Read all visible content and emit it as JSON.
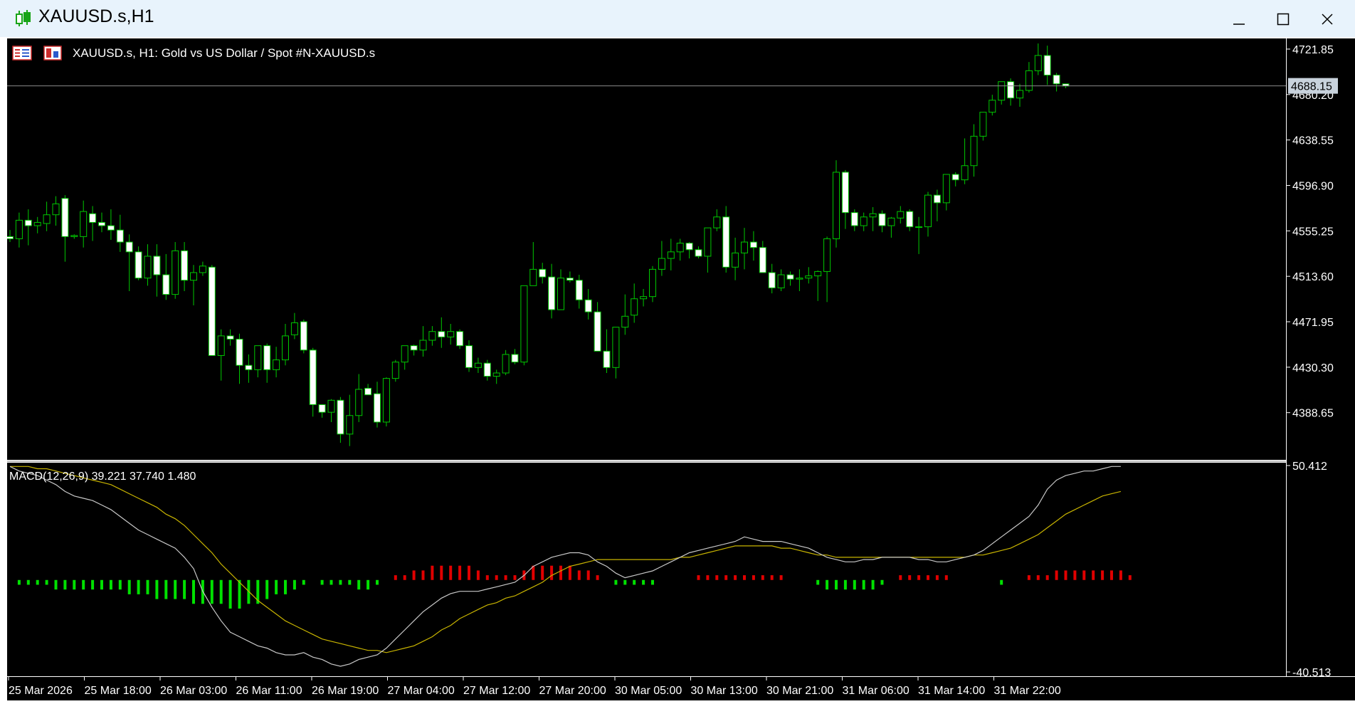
{
  "window": {
    "title": "XAUUSD.s,H1",
    "minimize": "—",
    "maximize": "☐",
    "close": "✕"
  },
  "chart_info": {
    "header": "XAUUSD.s, H1:  Gold vs US Dollar / Spot #N-XAUUSD.s",
    "current_price": "4688.15",
    "macd_label": "MACD(12,26,9) 39.221 37.740 1.480",
    "icons": [
      "list-icon",
      "trade-panel-icon"
    ]
  },
  "colors": {
    "background": "#000000",
    "bull_candle": "#00c800",
    "bear_body": "#ffffff",
    "axis_text": "#ffffff",
    "macd_line": "#c8c8c8",
    "signal_line": "#c8b400",
    "hist_positive": "#e10000",
    "hist_negative": "#00e100",
    "titlebar": "#e8f3fc"
  },
  "chart_data": [
    {
      "type": "candlestick",
      "title": "XAUUSD.s, H1:  Gold vs US Dollar / Spot #N-XAUUSD.s",
      "ylim": [
        4348,
        4729
      ],
      "y_ticks": [
        "4721.85",
        "4680.20",
        "4638.55",
        "4596.90",
        "4555.25",
        "4513.60",
        "4471.95",
        "4430.30",
        "4388.65"
      ],
      "x_ticks": [
        "25 Mar 2026",
        "25 Mar 18:00",
        "26 Mar 03:00",
        "26 Mar 11:00",
        "26 Mar 19:00",
        "27 Mar 04:00",
        "27 Mar 12:00",
        "27 Mar 20:00",
        "30 Mar 05:00",
        "30 Mar 13:00",
        "30 Mar 21:00",
        "31 Mar 06:00",
        "31 Mar 14:00",
        "31 Mar 22:00"
      ],
      "current_price": 4688.15,
      "ohlc": [
        [
          4550,
          4556,
          4545,
          4548
        ],
        [
          4548,
          4572,
          4540,
          4565
        ],
        [
          4565,
          4575,
          4542,
          4560
        ],
        [
          4560,
          4568,
          4553,
          4563
        ],
        [
          4562,
          4582,
          4555,
          4570
        ],
        [
          4570,
          4587,
          4560,
          4580
        ],
        [
          4585,
          4588,
          4527,
          4550
        ],
        [
          4550,
          4552,
          4548,
          4551
        ],
        [
          4550,
          4583,
          4540,
          4573
        ],
        [
          4571,
          4578,
          4546,
          4563
        ],
        [
          4563,
          4572,
          4554,
          4560
        ],
        [
          4560,
          4575,
          4547,
          4556
        ],
        [
          4556,
          4570,
          4536,
          4545
        ],
        [
          4545,
          4552,
          4500,
          4536
        ],
        [
          4536,
          4541,
          4510,
          4512
        ],
        [
          4512,
          4543,
          4505,
          4532
        ],
        [
          4532,
          4543,
          4495,
          4515
        ],
        [
          4515,
          4534,
          4492,
          4497
        ],
        [
          4497,
          4545,
          4493,
          4537
        ],
        [
          4537,
          4545,
          4500,
          4510
        ],
        [
          4510,
          4524,
          4487,
          4517
        ],
        [
          4517,
          4527,
          4514,
          4523
        ],
        [
          4522,
          4524,
          4447,
          4441
        ],
        [
          4441,
          4465,
          4418,
          4459
        ],
        [
          4459,
          4465,
          4450,
          4456
        ],
        [
          4456,
          4461,
          4415,
          4432
        ],
        [
          4432,
          4442,
          4416,
          4428
        ],
        [
          4428,
          4446,
          4421,
          4450
        ],
        [
          4450,
          4452,
          4416,
          4428
        ],
        [
          4428,
          4449,
          4421,
          4437
        ],
        [
          4437,
          4470,
          4432,
          4459
        ],
        [
          4460,
          4480,
          4456,
          4471
        ],
        [
          4472,
          4474,
          4443,
          4446
        ],
        [
          4446,
          4448,
          4385,
          4396
        ],
        [
          4396,
          4396,
          4384,
          4389
        ],
        [
          4389,
          4401,
          4380,
          4400
        ],
        [
          4400,
          4403,
          4361,
          4369
        ],
        [
          4369,
          4405,
          4358,
          4386
        ],
        [
          4386,
          4424,
          4380,
          4410
        ],
        [
          4411,
          4415,
          4408,
          4405
        ],
        [
          4406,
          4417,
          4375,
          4380
        ],
        [
          4380,
          4421,
          4376,
          4420
        ],
        [
          4420,
          4437,
          4417,
          4435
        ],
        [
          4435,
          4445,
          4428,
          4450
        ],
        [
          4450,
          4451,
          4441,
          4446
        ],
        [
          4446,
          4468,
          4440,
          4455
        ],
        [
          4455,
          4468,
          4450,
          4463
        ],
        [
          4463,
          4476,
          4448,
          4458
        ],
        [
          4458,
          4470,
          4451,
          4463
        ],
        [
          4463,
          4465,
          4447,
          4450
        ],
        [
          4450,
          4455,
          4426,
          4430
        ],
        [
          4430,
          4439,
          4425,
          4434
        ],
        [
          4434,
          4437,
          4418,
          4422
        ],
        [
          4422,
          4428,
          4415,
          4425
        ],
        [
          4425,
          4446,
          4423,
          4442
        ],
        [
          4442,
          4447,
          4433,
          4435
        ],
        [
          4435,
          4503,
          4432,
          4505
        ],
        [
          4505,
          4545,
          4505,
          4520
        ],
        [
          4520,
          4526,
          4507,
          4513
        ],
        [
          4513,
          4525,
          4475,
          4483
        ],
        [
          4483,
          4520,
          4483,
          4512
        ],
        [
          4512,
          4518,
          4508,
          4510
        ],
        [
          4510,
          4515,
          4484,
          4492
        ],
        [
          4492,
          4502,
          4474,
          4481
        ],
        [
          4481,
          4490,
          4452,
          4445
        ],
        [
          4445,
          4465,
          4425,
          4430
        ],
        [
          4430,
          4466,
          4420,
          4467
        ],
        [
          4467,
          4497,
          4460,
          4477
        ],
        [
          4478,
          4507,
          4471,
          4493
        ],
        [
          4493,
          4502,
          4486,
          4495
        ],
        [
          4495,
          4523,
          4490,
          4520
        ],
        [
          4520,
          4546,
          4514,
          4530
        ],
        [
          4530,
          4548,
          4519,
          4536
        ],
        [
          4536,
          4548,
          4528,
          4544
        ],
        [
          4544,
          4545,
          4530,
          4538
        ],
        [
          4538,
          4541,
          4530,
          4532
        ],
        [
          4532,
          4552,
          4517,
          4558
        ],
        [
          4558,
          4575,
          4555,
          4568
        ],
        [
          4568,
          4578,
          4517,
          4522
        ],
        [
          4522,
          4549,
          4510,
          4535
        ],
        [
          4535,
          4558,
          4520,
          4545
        ],
        [
          4545,
          4555,
          4528,
          4540
        ],
        [
          4540,
          4546,
          4517,
          4517
        ],
        [
          4517,
          4525,
          4498,
          4503
        ],
        [
          4503,
          4520,
          4500,
          4515
        ],
        [
          4515,
          4518,
          4505,
          4511
        ],
        [
          4511,
          4520,
          4500,
          4512
        ],
        [
          4512,
          4522,
          4507,
          4514
        ],
        [
          4514,
          4519,
          4491,
          4518
        ],
        [
          4518,
          4550,
          4490,
          4548
        ],
        [
          4548,
          4620,
          4540,
          4609
        ],
        [
          4609,
          4611,
          4557,
          4572
        ],
        [
          4572,
          4575,
          4555,
          4560
        ],
        [
          4560,
          4572,
          4555,
          4568
        ],
        [
          4568,
          4577,
          4555,
          4571
        ],
        [
          4571,
          4574,
          4554,
          4560
        ],
        [
          4560,
          4568,
          4549,
          4567
        ],
        [
          4567,
          4578,
          4562,
          4573
        ],
        [
          4573,
          4575,
          4555,
          4559
        ],
        [
          4559,
          4568,
          4534,
          4559
        ],
        [
          4559,
          4591,
          4550,
          4588
        ],
        [
          4588,
          4593,
          4564,
          4581
        ],
        [
          4581,
          4602,
          4574,
          4607
        ],
        [
          4607,
          4609,
          4596,
          4602
        ],
        [
          4602,
          4640,
          4598,
          4615
        ],
        [
          4615,
          4653,
          4605,
          4642
        ],
        [
          4642,
          4664,
          4638,
          4664
        ],
        [
          4664,
          4680,
          4661,
          4675
        ],
        [
          4675,
          4691,
          4671,
          4692
        ],
        [
          4692,
          4695,
          4670,
          4677
        ],
        [
          4677,
          4690,
          4669,
          4684
        ],
        [
          4684,
          4710,
          4682,
          4702
        ],
        [
          4702,
          4727,
          4698,
          4716
        ],
        [
          4716,
          4725,
          4689,
          4698
        ],
        [
          4698,
          4700,
          4683,
          4690
        ],
        [
          4690,
          4690,
          4686,
          4688
        ]
      ]
    },
    {
      "type": "line",
      "title": "MACD(12,26,9) 39.221 37.740 1.480",
      "ylim": [
        -40.513,
        50.412
      ],
      "y_ticks": [
        "50.412",
        "-40.513"
      ],
      "series": [
        {
          "name": "MACD",
          "values": [
            50,
            48,
            47,
            46,
            44,
            42,
            39,
            37,
            36,
            35,
            33,
            31,
            28,
            25,
            22,
            20,
            18,
            16,
            14,
            10,
            5,
            -5,
            -12,
            -18,
            -23,
            -25,
            -27,
            -29,
            -30,
            -32,
            -33,
            -33,
            -32,
            -34,
            -35,
            -37,
            -38,
            -37,
            -35,
            -34,
            -33,
            -30,
            -26,
            -22,
            -18,
            -14,
            -11,
            -8,
            -6,
            -5,
            -5,
            -5,
            -4,
            -3,
            -2,
            -1,
            2,
            6,
            8,
            10,
            11,
            12,
            12,
            11,
            8,
            6,
            3,
            1,
            2,
            3,
            4,
            6,
            8,
            10,
            12,
            13,
            14,
            15,
            16,
            17,
            19,
            18,
            17,
            17,
            17,
            16,
            15,
            14,
            12,
            10,
            9,
            8,
            8,
            9,
            9,
            10,
            10,
            10,
            10,
            9,
            9,
            8,
            8,
            9,
            10,
            11,
            13,
            16,
            19,
            22,
            25,
            28,
            33,
            40,
            44,
            46,
            47,
            48,
            48,
            49,
            50,
            50
          ]
        },
        {
          "name": "Signal",
          "values": [
            50,
            50,
            50,
            49,
            49,
            48,
            47,
            46,
            45,
            44,
            43,
            42,
            40,
            38,
            36,
            34,
            32,
            29,
            27,
            24,
            20,
            16,
            12,
            7,
            3,
            -1,
            -5,
            -9,
            -12,
            -15,
            -18,
            -20,
            -22,
            -24,
            -26,
            -27,
            -28,
            -29,
            -30,
            -31,
            -31,
            -32,
            -31,
            -30,
            -29,
            -27,
            -25,
            -22,
            -20,
            -17,
            -15,
            -13,
            -11,
            -10,
            -8,
            -7,
            -5,
            -3,
            -1,
            2,
            4,
            6,
            7,
            8,
            9,
            9,
            9,
            9,
            9,
            9,
            9,
            9,
            9,
            10,
            10,
            11,
            12,
            13,
            14,
            15,
            15,
            15,
            15,
            15,
            14,
            14,
            13,
            12,
            11,
            11,
            10,
            10,
            10,
            10,
            10,
            10,
            10,
            10,
            10,
            10,
            10,
            10,
            10,
            10,
            10,
            11,
            11,
            12,
            13,
            14,
            16,
            18,
            20,
            23,
            26,
            29,
            31,
            33,
            35,
            37,
            38,
            39
          ]
        },
        {
          "name": "Histogram",
          "values": [
            0,
            -1,
            -1,
            -1,
            -1,
            -2,
            -2,
            -2,
            -2,
            -2,
            -2,
            -2,
            -2,
            -3,
            -3,
            -3,
            -4,
            -4,
            -4,
            -4,
            -5,
            -5,
            -5,
            -5,
            -6,
            -6,
            -5,
            -5,
            -4,
            -3,
            -3,
            -2,
            -1,
            0,
            -1,
            -1,
            -1,
            -1,
            -2,
            -2,
            -1,
            0,
            1,
            1,
            2,
            2,
            3,
            3,
            3,
            3,
            3,
            2,
            1,
            1,
            1,
            1,
            2,
            3,
            3,
            3,
            3,
            3,
            2,
            2,
            1,
            0,
            -1,
            -1,
            -1,
            -1,
            -1,
            0,
            0,
            0,
            0,
            1,
            1,
            1,
            1,
            1,
            1,
            1,
            1,
            1,
            1,
            0,
            0,
            0,
            -1,
            -2,
            -2,
            -2,
            -2,
            -2,
            -2,
            -1,
            0,
            1,
            1,
            1,
            1,
            1,
            1,
            0,
            0,
            0,
            0,
            0,
            -1,
            0,
            0,
            1,
            1,
            1,
            2,
            2,
            2,
            2,
            2,
            2,
            2,
            2,
            1
          ]
        }
      ]
    }
  ]
}
